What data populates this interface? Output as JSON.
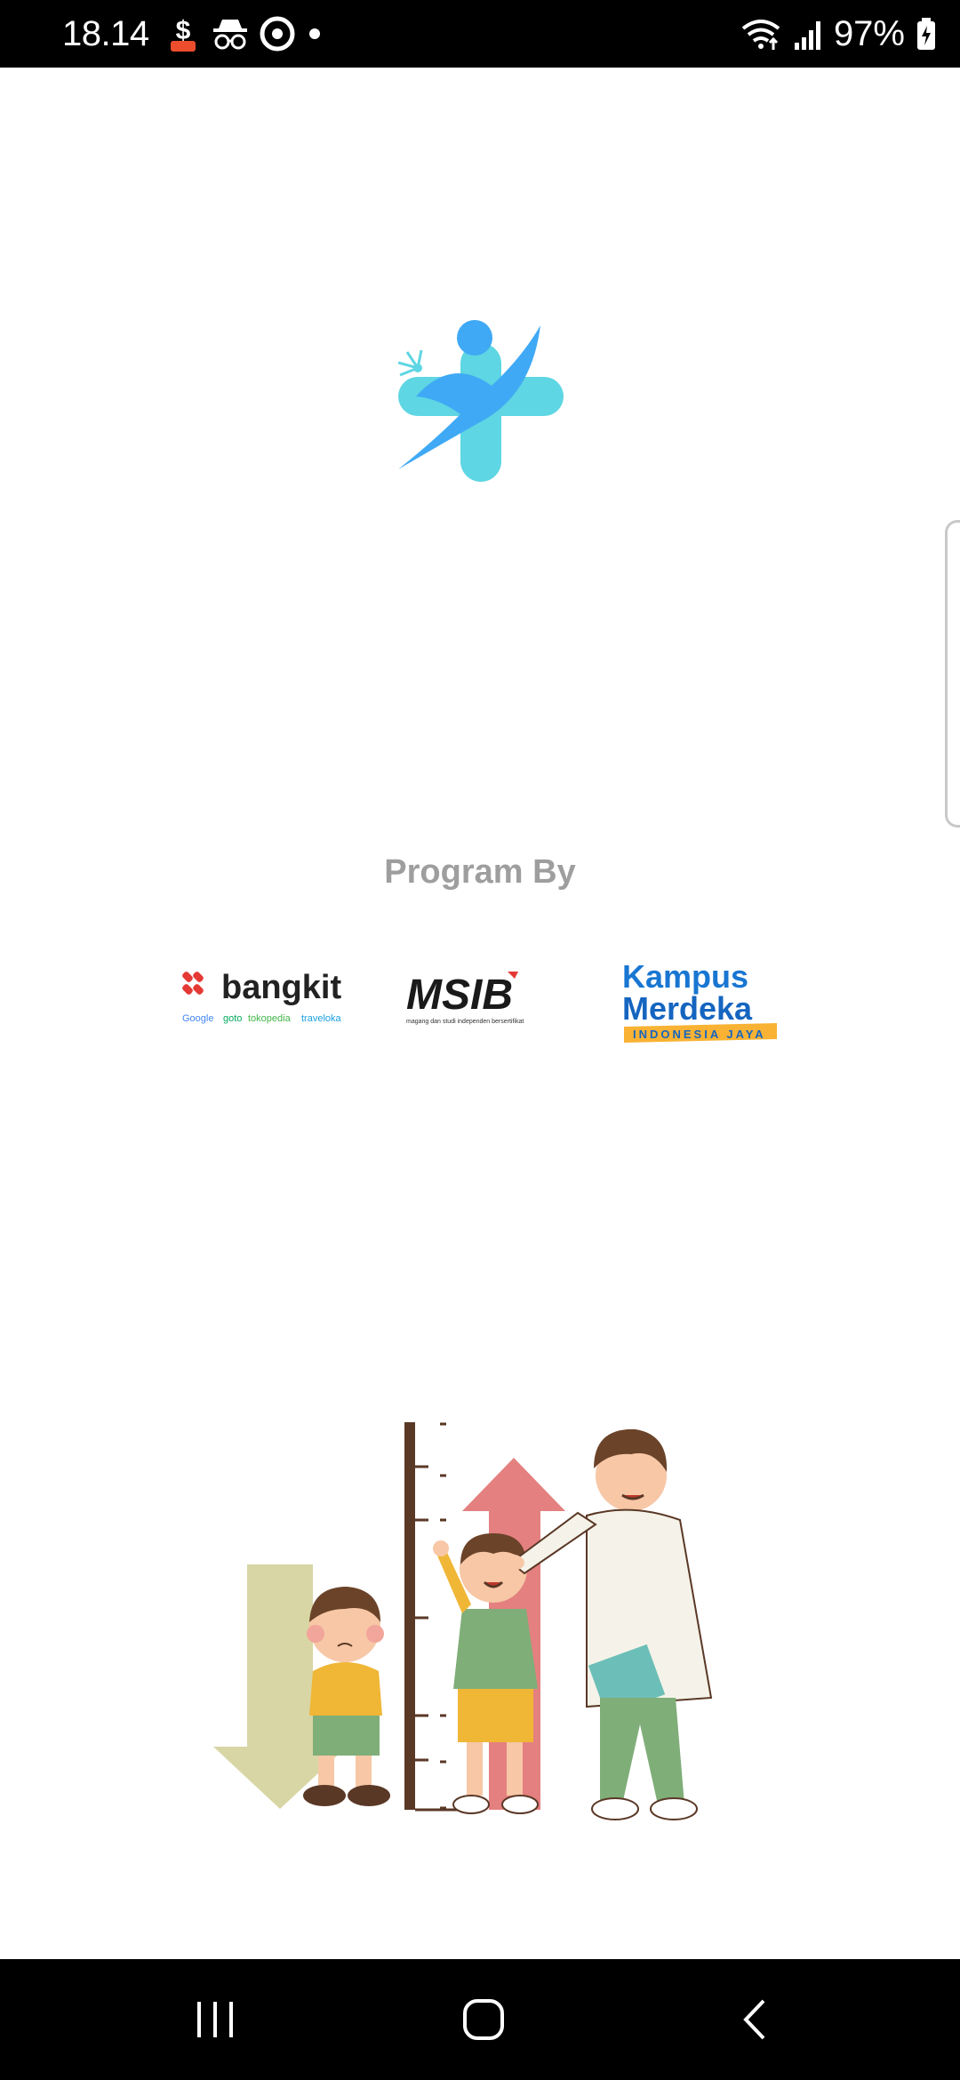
{
  "status_bar": {
    "time": "18.14",
    "battery_percent": "97%",
    "icons": [
      "shopee-icon",
      "incognito-icon",
      "target-icon",
      "dot-icon",
      "wifi-icon",
      "signal-icon",
      "battery-charging-icon"
    ]
  },
  "app": {
    "logo_icon": "health-cross-person-icon",
    "program_label": "Program By",
    "partners": [
      {
        "name": "bangkit",
        "wordmark": "bangkit",
        "sub": [
          "Google",
          "goto",
          "tokopedia",
          "traveloka"
        ]
      },
      {
        "name": "msib",
        "wordmark": "MSIB",
        "sub": "magang dan studi independen bersertifikat"
      },
      {
        "name": "kampus-merdeka",
        "line1": "Kampus",
        "line2": "Merdeka",
        "ribbon": "INDONESIA JAYA"
      }
    ],
    "illustration_icon": "child-growth-illustration"
  },
  "nav_bar": {
    "recent_icon": "recent-apps-icon",
    "home_icon": "home-icon",
    "back_icon": "back-icon"
  },
  "colors": {
    "logo_blue": "#3FA9F5",
    "logo_cyan": "#5ED6E3",
    "program_text": "#9E9E9E",
    "arrow_up": "#E48080",
    "arrow_down": "#D8D6A4"
  }
}
